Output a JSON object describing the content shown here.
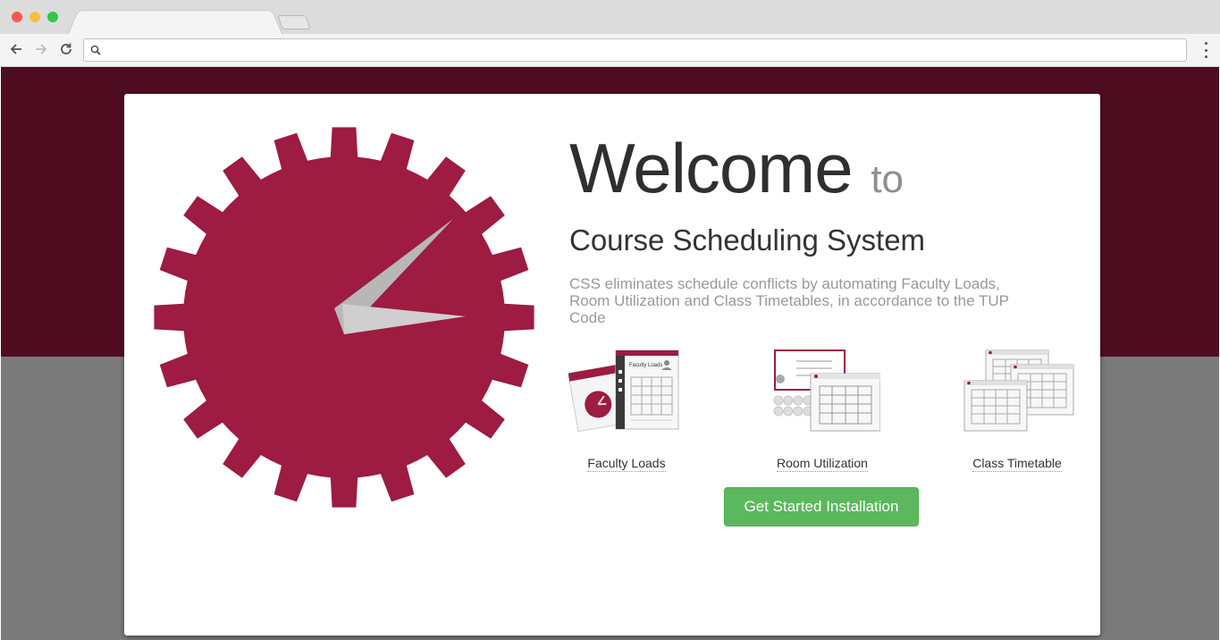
{
  "browser": {
    "active_tab_title": "",
    "address": "",
    "dot_colors": [
      "#fc5753",
      "#fdbc40",
      "#33c748"
    ]
  },
  "hero": {
    "welcome": "Welcome",
    "to": "to",
    "subtitle": "Course Scheduling System",
    "description": "CSS eliminates schedule conflicts by automating Faculty Loads, Room Utilization and Class Timetables, in accordance to the TUP Code"
  },
  "features": [
    {
      "label": "Faculty Loads",
      "icon": "faculty-loads-illustration",
      "inner_caption": "Faculty Loads"
    },
    {
      "label": "Room Utilization",
      "icon": "room-utilization-illustration"
    },
    {
      "label": "Class Timetable",
      "icon": "class-timetable-illustration"
    }
  ],
  "cta": {
    "label": "Get Started Installation"
  },
  "colors": {
    "brand_maroon": "#9e1b42",
    "band": "#4e0d20",
    "background_gray": "#7a7a7a",
    "button_green": "#5cb85c"
  }
}
